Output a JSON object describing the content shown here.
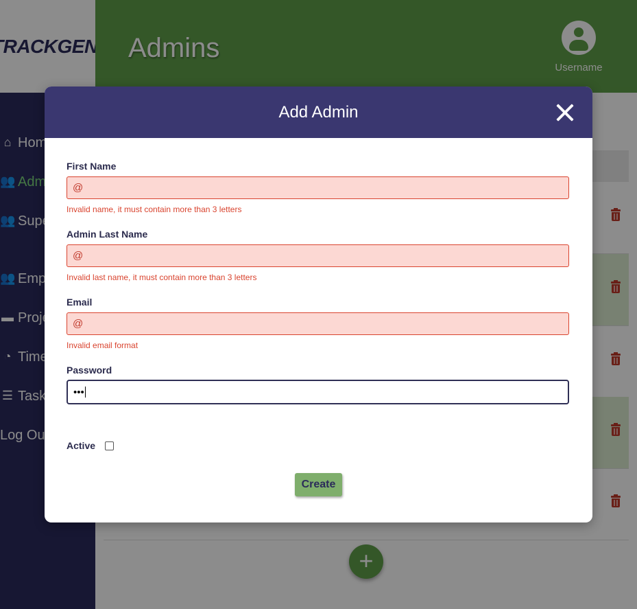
{
  "app": {
    "logo": "TRACKGENIX",
    "page_title": "Admins",
    "username": "Username"
  },
  "sidebar": {
    "items": [
      {
        "label": "Home",
        "icon": "home-icon"
      },
      {
        "label": "Admins",
        "icon": "users-icon"
      },
      {
        "label": "Super Admins",
        "icon": "users-icon"
      },
      {
        "label": "Employees",
        "icon": "users-icon"
      },
      {
        "label": "Projects",
        "icon": "folder-icon"
      },
      {
        "label": "Timesheets",
        "icon": "clock-icon"
      },
      {
        "label": "Tasks",
        "icon": "tasks-icon"
      },
      {
        "label": "Log Out",
        "icon": ""
      }
    ],
    "active": "Admins"
  },
  "modal": {
    "title": "Add Admin",
    "fields": [
      {
        "label": "First Name",
        "value": "@",
        "error": "Invalid name, it must contain more than 3 letters"
      },
      {
        "label": "Admin Last Name",
        "value": "@",
        "error": "Invalid last name, it must contain more than 3 letters"
      },
      {
        "label": "Email",
        "value": "@",
        "error": "Invalid email format"
      },
      {
        "label": "Password",
        "value": "•••",
        "error": ""
      }
    ],
    "active_label": "Active",
    "active_checked": false,
    "create_label": "Create"
  },
  "colors": {
    "header_green": "#5f9e4a",
    "sidebar_navy": "#2a2a5e",
    "modal_header": "#3a3770",
    "error_red": "#d9432e",
    "create_button": "#7fae6c"
  }
}
